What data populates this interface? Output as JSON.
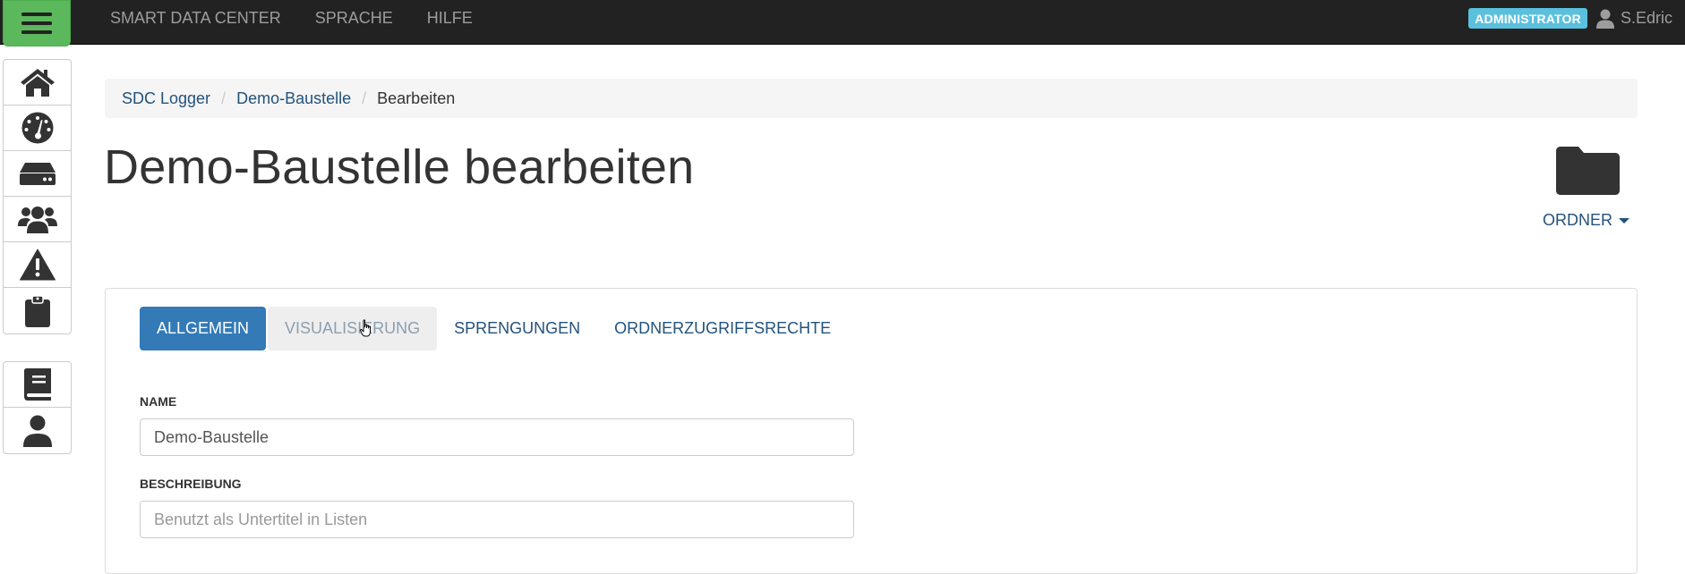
{
  "navbar": {
    "menu_icon": "hamburger-icon",
    "links": [
      "SMART DATA CENTER",
      "SPRACHE",
      "HILFE"
    ],
    "role_badge": "ADMINISTRATOR",
    "user_name": "S.Edric",
    "user_icon": "user-icon"
  },
  "sidebar": {
    "primary": [
      {
        "icon": "home-icon"
      },
      {
        "icon": "dashboard-icon"
      },
      {
        "icon": "hard-drive-icon"
      },
      {
        "icon": "users-icon"
      },
      {
        "icon": "warning-icon"
      },
      {
        "icon": "clipboard-icon"
      }
    ],
    "secondary": [
      {
        "icon": "book-icon"
      },
      {
        "icon": "user-icon"
      }
    ]
  },
  "breadcrumb": [
    "SDC Logger",
    "Demo-Baustelle",
    "Bearbeiten"
  ],
  "page": {
    "title": "Demo-Baustelle bearbeiten",
    "folder_icon": "folder-icon",
    "folder_dropdown": "ORDNER"
  },
  "tabs": [
    "ALLGEMEIN",
    "VISUALISIERUNG",
    "SPRENGUNGEN",
    "ORDNERZUGRIFFSRECHTE"
  ],
  "active_tab": "ALLGEMEIN",
  "form": {
    "name_label": "NAME",
    "name_value": "Demo-Baustelle",
    "description_label": "BESCHREIBUNG",
    "description_placeholder": "Benutzt als Untertitel in Listen"
  },
  "colors": {
    "navbar": "#222222",
    "menu_toggle": "#5cb85c",
    "badge": "#5bc0de",
    "active_tab": "#337ab7",
    "link": "#23527c"
  }
}
